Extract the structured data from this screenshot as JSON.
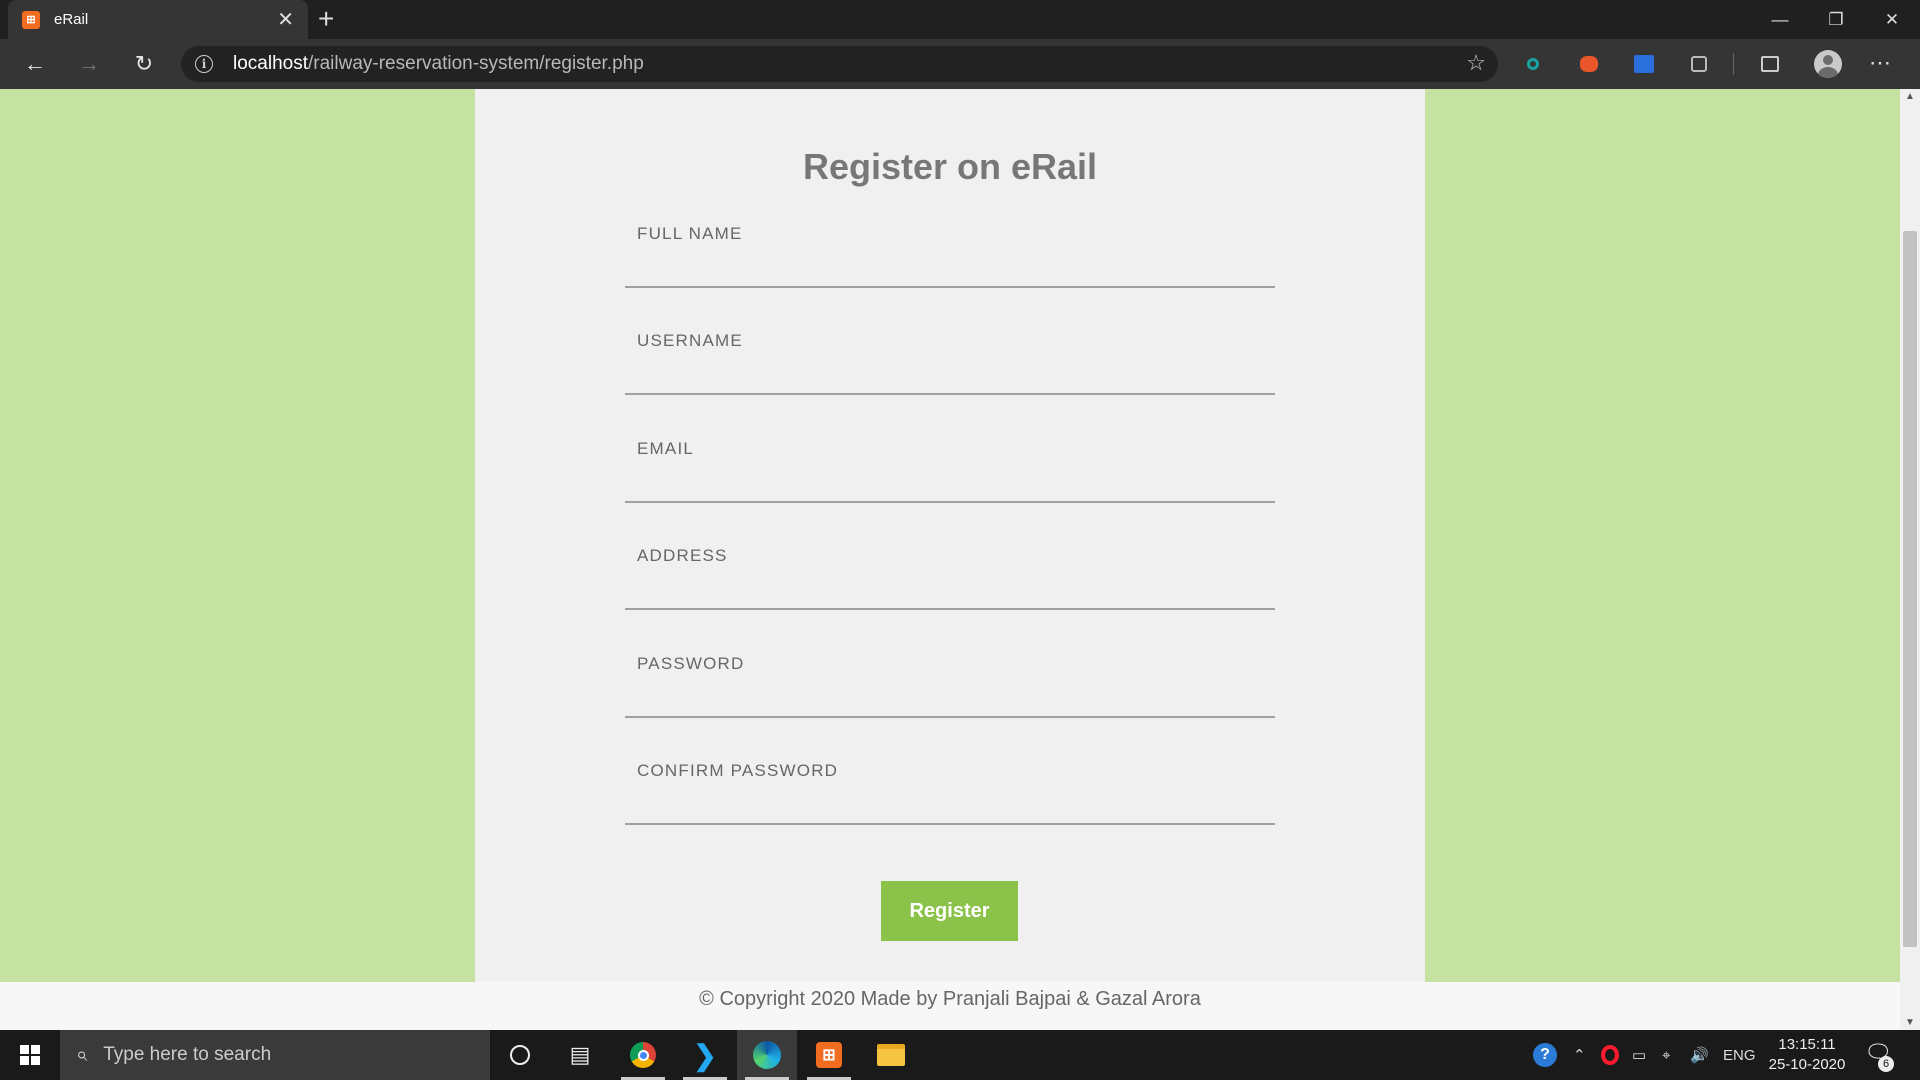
{
  "browser": {
    "tab_title": "eRail",
    "tab_favicon": "xampp-icon",
    "url_host": "localhost",
    "url_path": "/railway-reservation-system/register.php"
  },
  "form": {
    "title": "Register on eRail",
    "fields": [
      {
        "label": "FULL NAME",
        "value": ""
      },
      {
        "label": "USERNAME",
        "value": ""
      },
      {
        "label": "EMAIL",
        "value": ""
      },
      {
        "label": "ADDRESS",
        "value": ""
      },
      {
        "label": "PASSWORD",
        "value": ""
      },
      {
        "label": "CONFIRM PASSWORD",
        "value": ""
      }
    ],
    "submit_label": "Register"
  },
  "footer": {
    "text": "© Copyright 2020 Made by Pranjali Bajpai & Gazal Arora"
  },
  "taskbar": {
    "search_placeholder": "Type here to search",
    "language": "ENG",
    "time": "13:15:11",
    "date": "25-10-2020",
    "notification_count": "6"
  },
  "colors": {
    "page_background": "#c6e2a3",
    "card_background": "#f0f0f0",
    "accent": "#8bc34a"
  }
}
